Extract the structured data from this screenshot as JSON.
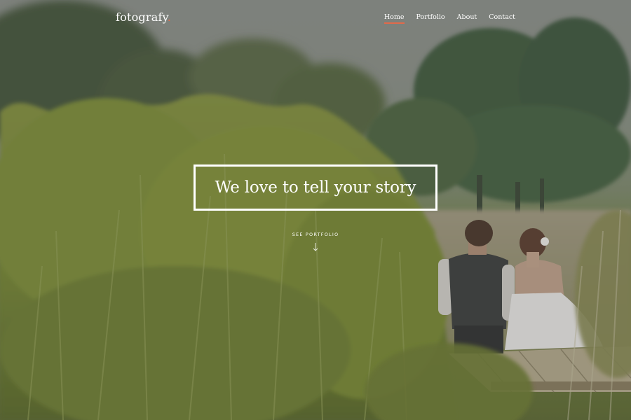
{
  "header": {
    "brand": "fotografy",
    "brand_dot": ".",
    "nav": [
      {
        "label": "Home",
        "active": true
      },
      {
        "label": "Portfolio",
        "active": false
      },
      {
        "label": "About",
        "active": false
      },
      {
        "label": "Contact",
        "active": false
      }
    ]
  },
  "hero": {
    "headline": "We love to tell your story",
    "cta_label": "SEE PORTFOLIO",
    "cta_icon": "arrow-down-icon"
  },
  "colors": {
    "accent": "#e26a4a",
    "text": "#ffffff"
  }
}
